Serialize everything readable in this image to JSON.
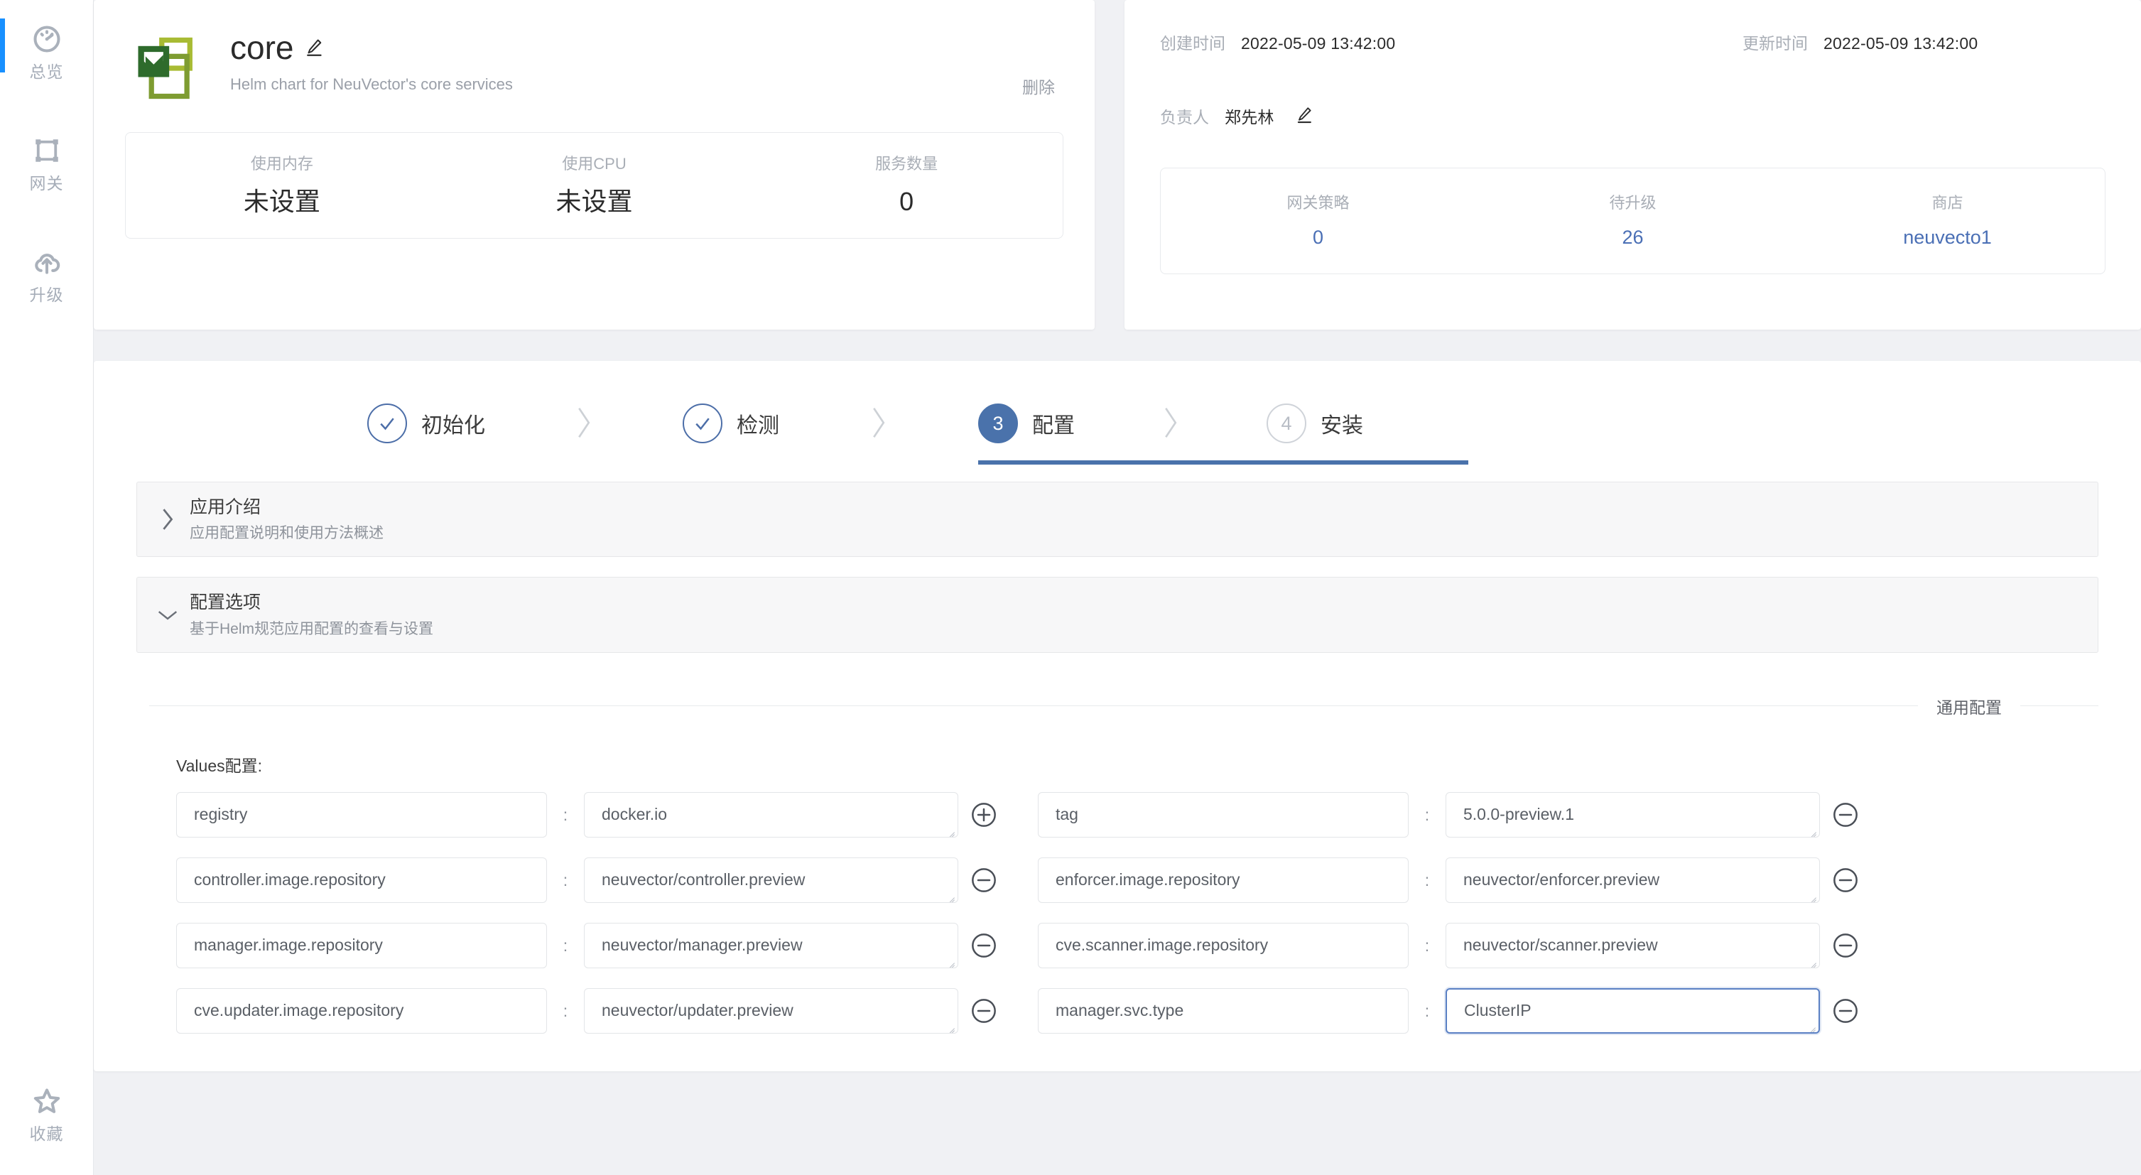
{
  "sidebar": {
    "items": [
      {
        "label": "总览",
        "icon": "dashboard-icon",
        "active": true
      },
      {
        "label": "网关",
        "icon": "gateway-icon",
        "active": false
      },
      {
        "label": "升级",
        "icon": "upgrade-cloud-icon",
        "active": false
      }
    ],
    "bottom_item": {
      "label": "收藏",
      "icon": "star-icon"
    }
  },
  "overview": {
    "app_name": "core",
    "app_description": "Helm chart for NeuVector's core services",
    "edit_icon": "pencil-icon",
    "delete_label": "删除",
    "stats": [
      {
        "label": "使用内存",
        "value": "未设置"
      },
      {
        "label": "使用CPU",
        "value": "未设置"
      },
      {
        "label": "服务数量",
        "value": "0"
      }
    ]
  },
  "meta": {
    "created_label": "创建时间",
    "created_value": "2022-05-09 13:42:00",
    "updated_label": "更新时间",
    "updated_value": "2022-05-09 13:42:00",
    "owner_label": "负责人",
    "owner_value": "郑先林",
    "owner_edit_icon": "pencil-icon",
    "stats": [
      {
        "label": "网关策略",
        "value": "0"
      },
      {
        "label": "待升级",
        "value": "26"
      },
      {
        "label": "商店",
        "value": "neuvecto1"
      }
    ]
  },
  "stepper": {
    "steps": [
      {
        "num": "1",
        "label": "初始化",
        "state": "done"
      },
      {
        "num": "2",
        "label": "检测",
        "state": "done"
      },
      {
        "num": "3",
        "label": "配置",
        "state": "current"
      },
      {
        "num": "4",
        "label": "安装",
        "state": "todo"
      }
    ]
  },
  "accordions": [
    {
      "title": "应用介绍",
      "subtitle": "应用配置说明和使用方法概述",
      "expanded": false,
      "caret": "chevron-right-icon"
    },
    {
      "title": "配置选项",
      "subtitle": "基于Helm规范应用配置的查看与设置",
      "expanded": true,
      "caret": "chevron-down-icon"
    }
  ],
  "config": {
    "section_divider_label": "通用配置",
    "values_label": "Values配置:",
    "colon": ":",
    "rows": [
      {
        "left": {
          "key": "registry",
          "value": "docker.io",
          "action": "add",
          "action_icon": "plus-circle-icon"
        },
        "right": {
          "key": "tag",
          "value": "5.0.0-preview.1",
          "action": "remove",
          "action_icon": "minus-circle-icon"
        }
      },
      {
        "left": {
          "key": "controller.image.repository",
          "value": "neuvector/controller.preview",
          "action": "remove",
          "action_icon": "minus-circle-icon"
        },
        "right": {
          "key": "enforcer.image.repository",
          "value": "neuvector/enforcer.preview",
          "action": "remove",
          "action_icon": "minus-circle-icon"
        }
      },
      {
        "left": {
          "key": "manager.image.repository",
          "value": "neuvector/manager.preview",
          "action": "remove",
          "action_icon": "minus-circle-icon"
        },
        "right": {
          "key": "cve.scanner.image.repository",
          "value": "neuvector/scanner.preview",
          "action": "remove",
          "action_icon": "minus-circle-icon"
        }
      },
      {
        "left": {
          "key": "cve.updater.image.repository",
          "value": "neuvector/updater.preview",
          "action": "remove",
          "action_icon": "minus-circle-icon"
        },
        "right": {
          "key": "manager.svc.type",
          "value": "ClusterIP",
          "action": "remove",
          "action_icon": "minus-circle-icon",
          "focused": true
        }
      }
    ]
  },
  "colors": {
    "page_bg": "#f0f1f4",
    "accent_blue": "#1890ff",
    "step_blue": "#4a72ab",
    "link_blue": "#4a6fb5",
    "logo_dark_green": "#2e6b2c",
    "logo_olive": "#7e9c31",
    "logo_yellow_green": "#a8bb33"
  }
}
